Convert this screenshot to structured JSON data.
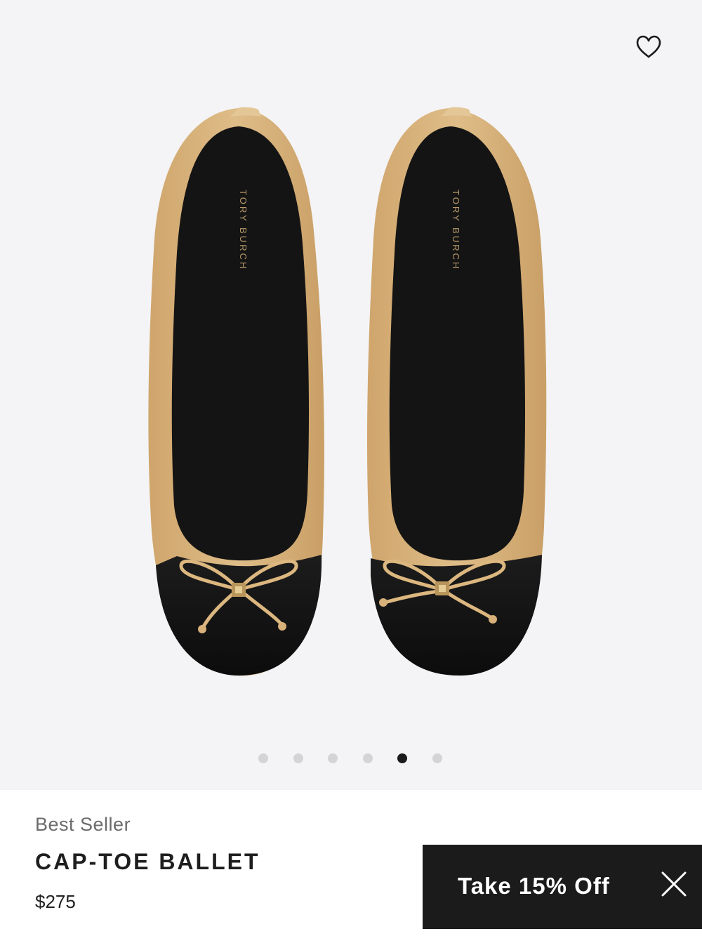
{
  "product": {
    "badge": "Best Seller",
    "name": "CAP-TOE BALLET",
    "price": "$275",
    "image_alt": "Cap-toe ballet flats, tan leather with black toe cap and bow",
    "insole_brand": "TORY BURCH"
  },
  "gallery": {
    "total_images": 6,
    "active_index": 4,
    "wishlist_icon": "heart-outline-icon"
  },
  "promo": {
    "label": "Take 15% Off",
    "close_icon": "close-icon"
  },
  "colors": {
    "gallery_bg": "#f4f4f6",
    "tan_leather": "#d6b17b",
    "black_cap": "#121212",
    "promo_bg": "#1b1b1b"
  }
}
